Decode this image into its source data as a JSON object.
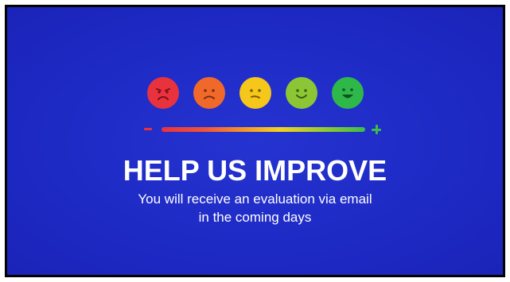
{
  "banner": {
    "headline": "HELP US IMPROVE",
    "subtitle_line1": "You will receive an evaluation via email",
    "subtitle_line2": "in the coming days"
  },
  "rating_scale": {
    "faces": [
      {
        "name": "very-dissatisfied-face-icon",
        "color": "#e8323e"
      },
      {
        "name": "dissatisfied-face-icon",
        "color": "#f0692a"
      },
      {
        "name": "neutral-face-icon",
        "color": "#f5c71a"
      },
      {
        "name": "satisfied-face-icon",
        "color": "#8cc634"
      },
      {
        "name": "very-satisfied-face-icon",
        "color": "#2fb84a"
      }
    ],
    "low_end_icon": "minus-icon",
    "high_end_icon": "plus-icon"
  },
  "colors": {
    "background": "#1d28c2",
    "text": "#ffffff"
  }
}
